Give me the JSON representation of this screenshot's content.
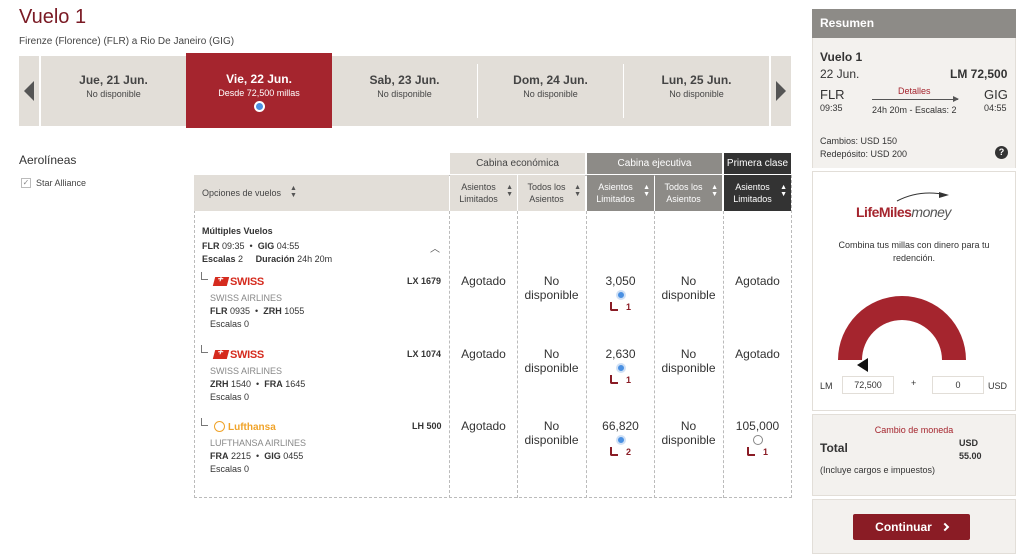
{
  "header": {
    "title": "Vuelo 1",
    "route": "Firenze (Florence) (FLR) a Rio De Janeiro (GIG)"
  },
  "dates": [
    {
      "label": "Jue, 21 Jun.",
      "status": "No disponible"
    },
    {
      "label": "Vie, 22 Jun.",
      "status": "Desde 72,500 millas",
      "selected": true
    },
    {
      "label": "Sab, 23 Jun.",
      "status": "No disponible"
    },
    {
      "label": "Dom, 24 Jun.",
      "status": "No disponible"
    },
    {
      "label": "Lun, 25 Jun.",
      "status": "No disponible"
    }
  ],
  "filters": {
    "title": "Aerolíneas",
    "alliance": "Star Alliance"
  },
  "cabins": {
    "economy": "Cabina económica",
    "business": "Cabina ejecutiva",
    "first": "Primera clase"
  },
  "table_headers": {
    "options": "Opciones de vuelos",
    "eco_limited": "Asientos Limitados",
    "eco_all": "Todos los Asientos",
    "bus_limited": "Asientos Limitados",
    "bus_all": "Todos los Asientos",
    "first_limited": "Asientos Limitados"
  },
  "itinerary": {
    "title": "Múltiples Vuelos",
    "from_code": "FLR",
    "dep_time": "09:35",
    "to_code": "GIG",
    "arr_time": "04:55",
    "stops_label": "Escalas",
    "stops": "2",
    "duration_label": "Duración",
    "duration": "24h 20m"
  },
  "segments": [
    {
      "airline_logo": "SWISS",
      "airline": "SWISS AIRLINES",
      "flight": "LX 1679",
      "from": "FLR",
      "dep": "0935",
      "to": "ZRH",
      "arr": "1055",
      "stops": "Escalas 0",
      "eco_limited": "Agotado",
      "eco_all": "No disponible",
      "bus_limited": "3,050",
      "bus_seats": "1",
      "bus_all": "No disponible",
      "first_limited": "Agotado"
    },
    {
      "airline_logo": "SWISS",
      "airline": "SWISS AIRLINES",
      "flight": "LX 1074",
      "from": "ZRH",
      "dep": "1540",
      "to": "FRA",
      "arr": "1645",
      "stops": "Escalas 0",
      "eco_limited": "Agotado",
      "eco_all": "No disponible",
      "bus_limited": "2,630",
      "bus_seats": "1",
      "bus_all": "No disponible",
      "first_limited": "Agotado"
    },
    {
      "airline_logo": "Lufthansa",
      "airline": "LUFTHANSA AIRLINES",
      "flight": "LH 500",
      "from": "FRA",
      "dep": "2215",
      "to": "GIG",
      "arr": "0455",
      "stops": "Escalas 0",
      "eco_limited": "Agotado",
      "eco_all": "No disponible",
      "bus_limited": "66,820",
      "bus_seats": "2",
      "bus_all": "No disponible",
      "first_limited": "105,000",
      "first_seats": "1"
    }
  ],
  "summary": {
    "title": "Resumen",
    "flight_label": "Vuelo 1",
    "date": "22 Jun.",
    "miles": "LM 72,500",
    "from": "FLR",
    "dep": "09:35",
    "to": "GIG",
    "arr": "04:55",
    "details_link": "Detalles",
    "duration_stops": "24h 20m - Escalas: 2",
    "changes": "Cambios: USD 150",
    "redeposit": "Redepósito: USD 200",
    "help": "?"
  },
  "lifemiles": {
    "logo_text": "LifeMiles",
    "logo_money": "money",
    "description": "Combina tus millas con dinero para tu redención.",
    "lm_label": "LM",
    "lm_value": "72,500",
    "plus": "+",
    "usd_value": "0",
    "usd_label": "USD",
    "slider_level": 0.0
  },
  "totals": {
    "currency_link": "Cambio de moneda",
    "total_label": "Total",
    "currency": "USD",
    "amount": "55.00",
    "note": "(Incluye cargos e impuestos)"
  },
  "actions": {
    "continue": "Continuar"
  },
  "colors": {
    "brand": "#a5252e",
    "dark_red": "#8a1c25",
    "beige": "#e2ded8",
    "grey": "#8d8b87",
    "dark": "#333333",
    "blue_dot": "#4a90e2"
  }
}
